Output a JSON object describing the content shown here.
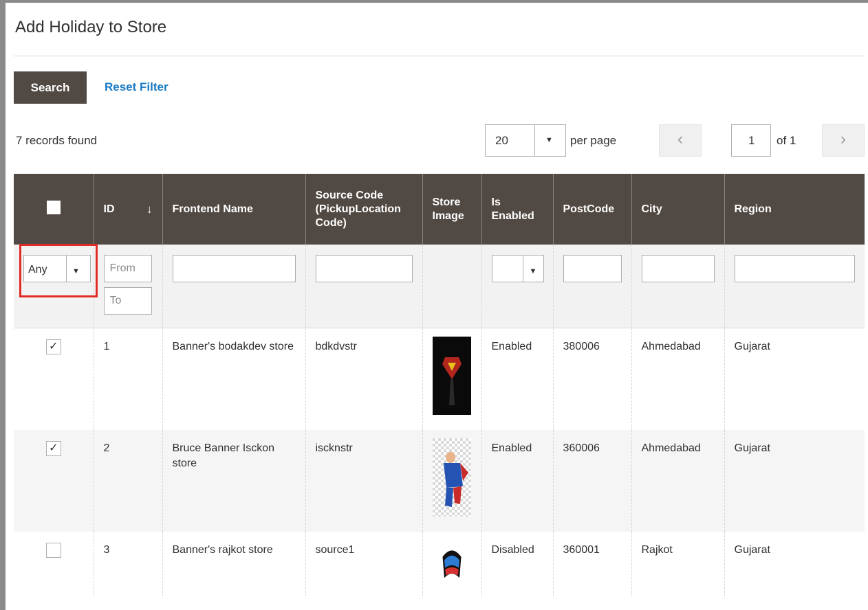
{
  "page": {
    "title": "Add Holiday to Store"
  },
  "toolbar": {
    "search_label": "Search",
    "reset_label": "Reset Filter",
    "records_text": "7 records found",
    "per_page_value": "20",
    "per_page_label": "per page",
    "prev_icon": "‹",
    "next_icon": "›",
    "current_page": "1",
    "total_pages_text": "of 1"
  },
  "grid": {
    "columns": [
      {
        "key": "select",
        "label": ""
      },
      {
        "key": "id",
        "label": "ID"
      },
      {
        "key": "frontend_name",
        "label": "Frontend Name"
      },
      {
        "key": "source_code",
        "label": "Source Code (PickupLocation Code)"
      },
      {
        "key": "store_image",
        "label": "Store Image"
      },
      {
        "key": "is_enabled",
        "label": "Is Enabled"
      },
      {
        "key": "postcode",
        "label": "PostCode"
      },
      {
        "key": "city",
        "label": "City"
      },
      {
        "key": "region",
        "label": "Region"
      }
    ],
    "sort_icon": "↓",
    "filters": {
      "select_value": "Any",
      "id_from_placeholder": "From",
      "id_to_placeholder": "To",
      "is_enabled_value": ""
    },
    "rows": [
      {
        "checked": true,
        "id": "1",
        "frontend_name": "Banner's bodakdev store",
        "source_code": "bdkdvstr",
        "is_enabled": "Enabled",
        "postcode": "380006",
        "city": "Ahmedabad",
        "region": "Gujarat"
      },
      {
        "checked": true,
        "id": "2",
        "frontend_name": "Bruce Banner Isckon store",
        "source_code": "isckn​str",
        "is_enabled": "Enabled",
        "postcode": "360006",
        "city": "Ahmedabad",
        "region": "Gujarat"
      },
      {
        "checked": false,
        "id": "3",
        "frontend_name": "Banner's rajkot store",
        "source_code": "source1",
        "is_enabled": "Disabled",
        "postcode": "360001",
        "city": "Rajkot",
        "region": "Gujarat"
      }
    ]
  },
  "colors": {
    "header_bg": "#514943",
    "link": "#1979c3",
    "highlight": "#e02b27"
  }
}
